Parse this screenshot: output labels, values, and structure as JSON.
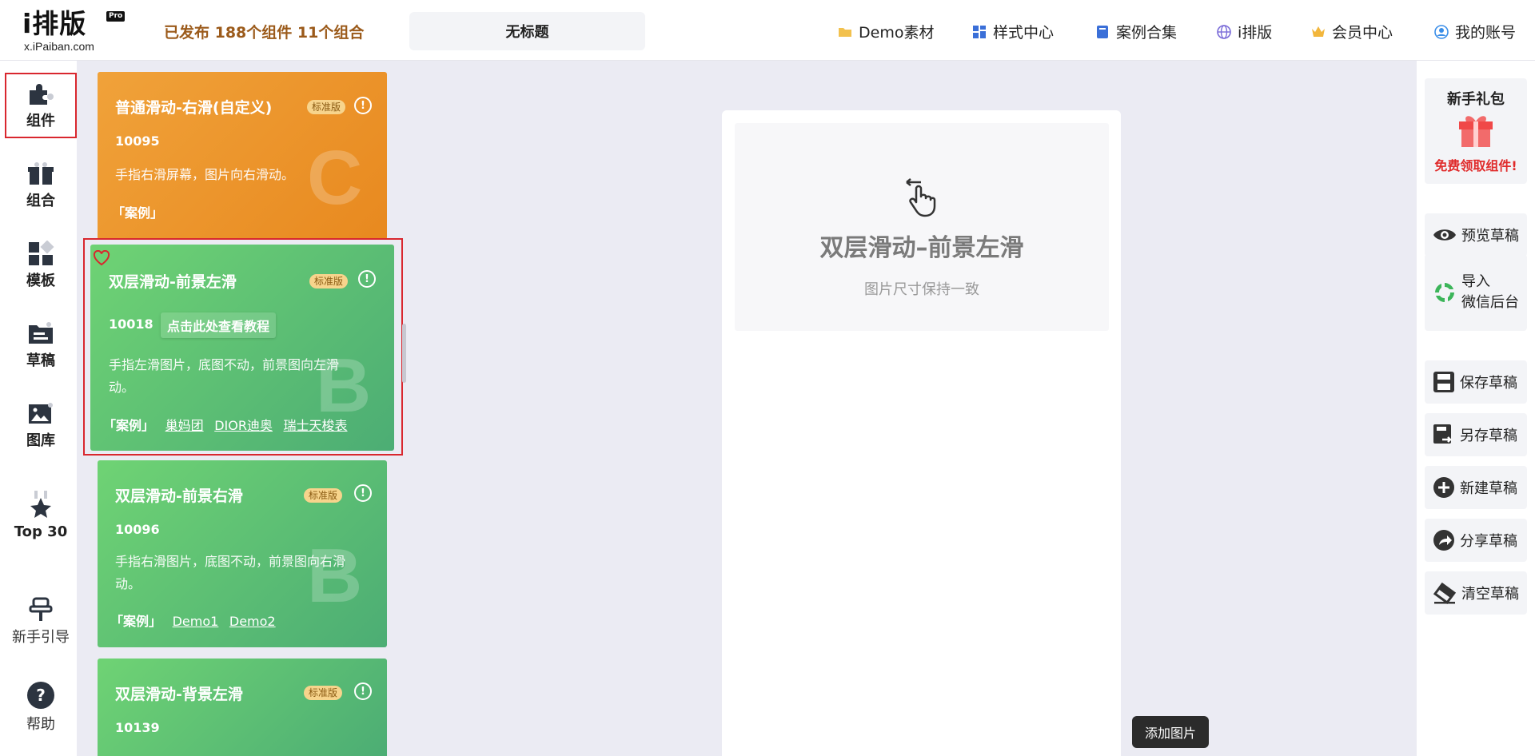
{
  "header": {
    "logo_main": "i排版",
    "logo_badge": "Pro",
    "logo_sub": "x.iPaiban.com",
    "pub_info": "已发布 188个组件 11个组合",
    "doc_title": "无标题",
    "nav": [
      {
        "label": "Demo素材",
        "icon": "folder-icon",
        "color": "#f2b63c"
      },
      {
        "label": "样式中心",
        "icon": "grid-icon",
        "color": "#3a6fd8"
      },
      {
        "label": "案例合集",
        "icon": "book-icon",
        "color": "#3a6fd8"
      },
      {
        "label": "i排版",
        "icon": "globe-icon",
        "color": "#7a6bd8"
      },
      {
        "label": "会员中心",
        "icon": "crown-icon",
        "color": "#f2b63c"
      },
      {
        "label": "我的账号",
        "icon": "user-icon",
        "color": "#3a8ee8"
      }
    ]
  },
  "sidebar": {
    "items": [
      {
        "label": "组件",
        "icon": "puzzle-icon"
      },
      {
        "label": "组合",
        "icon": "gift-box-icon"
      },
      {
        "label": "模板",
        "icon": "template-icon"
      },
      {
        "label": "草稿",
        "icon": "draft-icon"
      },
      {
        "label": "图库",
        "icon": "image-icon"
      },
      {
        "label": "Top 30",
        "icon": "medal-icon"
      },
      {
        "label": "新手引导",
        "icon": "guide-icon"
      },
      {
        "label": "帮助",
        "icon": "help-icon"
      }
    ]
  },
  "cards": [
    {
      "title": "普通滑动-右滑(自定义)",
      "badge": "标准版",
      "id": "10095",
      "desc": "手指右滑屏幕，图片向右滑动。",
      "links_label": "「案例」",
      "links": [],
      "letter": "C"
    },
    {
      "title": "双层滑动-前景左滑",
      "badge": "标准版",
      "id": "10018",
      "tutorial": "点击此处查看教程",
      "desc_line1": "手指左滑图片，底图不动，前景图向左滑",
      "desc_line2": "动。",
      "links_label": "「案例」",
      "links": [
        "巢妈团",
        "DIOR迪奥",
        "瑞士天梭表"
      ],
      "letter": "B"
    },
    {
      "title": "双层滑动-前景右滑",
      "badge": "标准版",
      "id": "10096",
      "desc_line1": "手指右滑图片，底图不动，前景图向右滑",
      "desc_line2": "动。",
      "links_label": "「案例」",
      "links": [
        "Demo1",
        "Demo2"
      ],
      "letter": "B"
    },
    {
      "title": "双层滑动-背景左滑",
      "badge": "标准版",
      "id": "10139"
    }
  ],
  "canvas": {
    "title": "双层滑动–前景左滑",
    "subtitle": "图片尺寸保持一致",
    "add_image": "添加图片"
  },
  "right_panel": {
    "gift_title": "新手礼包",
    "gift_sub": "免费领取组件!",
    "buttons": [
      {
        "label": "预览草稿",
        "icon": "eye-icon"
      },
      {
        "label1": "导入",
        "label2": "微信后台",
        "icon": "wechat-icon"
      },
      {
        "label": "保存草稿",
        "icon": "save-icon"
      },
      {
        "label": "另存草稿",
        "icon": "save-as-icon"
      },
      {
        "label": "新建草稿",
        "icon": "plus-circle-icon"
      },
      {
        "label": "分享草稿",
        "icon": "share-icon"
      },
      {
        "label": "清空草稿",
        "icon": "eraser-icon"
      }
    ]
  }
}
